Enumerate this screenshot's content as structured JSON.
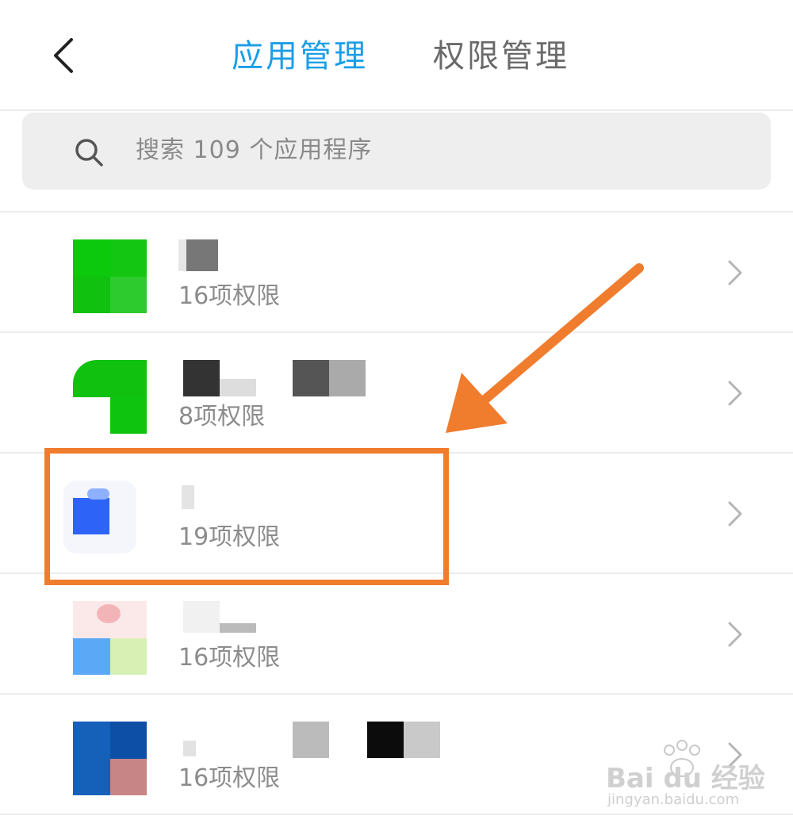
{
  "header": {
    "back_icon": "chevron-left-icon",
    "tabs": [
      {
        "label": "应用管理",
        "active": true
      },
      {
        "label": "权限管理",
        "active": false
      }
    ]
  },
  "search": {
    "icon": "search-icon",
    "placeholder": "搜索 109 个应用程序"
  },
  "apps": [
    {
      "permissions": "16项权限"
    },
    {
      "permissions": "8项权限"
    },
    {
      "permissions": "19项权限"
    },
    {
      "permissions": "16项权限"
    },
    {
      "permissions": "16项权限"
    }
  ],
  "colors": {
    "accent": "#1b9ee8",
    "highlight": "#f07c2e"
  },
  "watermark": {
    "brand": "Bai du 经验",
    "url": "jingyan.baidu.com"
  }
}
